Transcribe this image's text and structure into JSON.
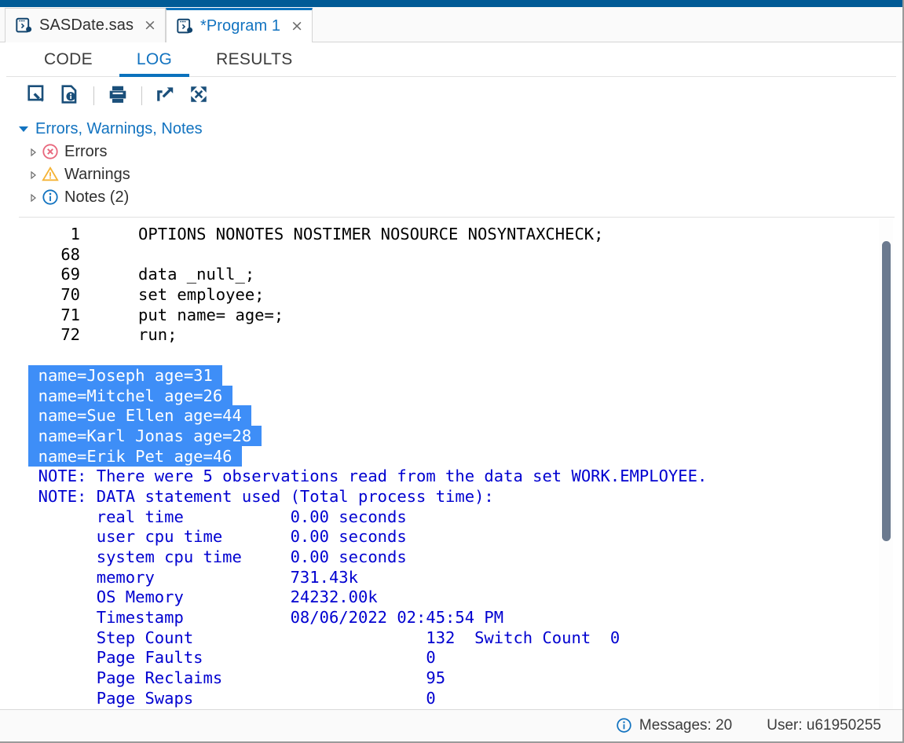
{
  "window": {
    "accent_color": "#015b96",
    "active_tab_color": "#1273c0",
    "selection_color": "#3e8ef7",
    "log_text_color": "#0000d0"
  },
  "file_tabs": [
    {
      "label": "SASDate.sas",
      "icon": "sas-program-icon",
      "close": "×",
      "active": false
    },
    {
      "label": "*Program 1",
      "icon": "sas-program-icon",
      "close": "×",
      "active": true
    }
  ],
  "section_tabs": [
    {
      "label": "CODE",
      "active": false
    },
    {
      "label": "LOG",
      "active": true
    },
    {
      "label": "RESULTS",
      "active": false
    }
  ],
  "toolbar": {
    "buttons": [
      {
        "name": "edit-log-icon",
        "title": "Edit"
      },
      {
        "name": "log-summary-icon",
        "title": "Log summary"
      },
      {
        "name": "print-icon",
        "title": "Print"
      },
      {
        "name": "open-in-new-window-icon",
        "title": "Open in new window"
      },
      {
        "name": "maximize-icon",
        "title": "Maximize view"
      }
    ]
  },
  "tree": {
    "root": "Errors, Warnings, Notes",
    "items": [
      {
        "label": "Errors",
        "icon": "error-icon",
        "color": "#e8687d"
      },
      {
        "label": "Warnings",
        "icon": "warning-icon",
        "color": "#f5b335"
      },
      {
        "label": "Notes (2)",
        "icon": "info-icon",
        "color": "#1273c0"
      }
    ]
  },
  "log": {
    "code_lines": [
      {
        "no": "1",
        "src": "OPTIONS NONOTES NOSTIMER NOSOURCE NOSYNTAXCHECK;"
      },
      {
        "no": "68",
        "src": ""
      },
      {
        "no": "69",
        "src": "data _null_;"
      },
      {
        "no": "70",
        "src": "set employee;"
      },
      {
        "no": "71",
        "src": "put name= age=;"
      },
      {
        "no": "72",
        "src": "run;"
      }
    ],
    "selected_output": [
      "name=Joseph age=31",
      "name=Mitchel age=26",
      "name=Sue Ellen age=44",
      "name=Karl Jonas age=28",
      "name=Erik Pet age=46"
    ],
    "note_lines": [
      "NOTE: There were 5 observations read from the data set WORK.EMPLOYEE.",
      "NOTE: DATA statement used (Total process time):",
      "      real time           0.00 seconds",
      "      user cpu time       0.00 seconds",
      "      system cpu time     0.00 seconds",
      "      memory              731.43k",
      "      OS Memory           24232.00k",
      "      Timestamp           08/06/2022 02:45:54 PM",
      "      Step Count                        132  Switch Count  0",
      "      Page Faults                       0",
      "      Page Reclaims                     95",
      "      Page Swaps                        0"
    ]
  },
  "status": {
    "messages_icon": "info-icon",
    "messages": "Messages: 20",
    "user": "User: u61950255"
  }
}
